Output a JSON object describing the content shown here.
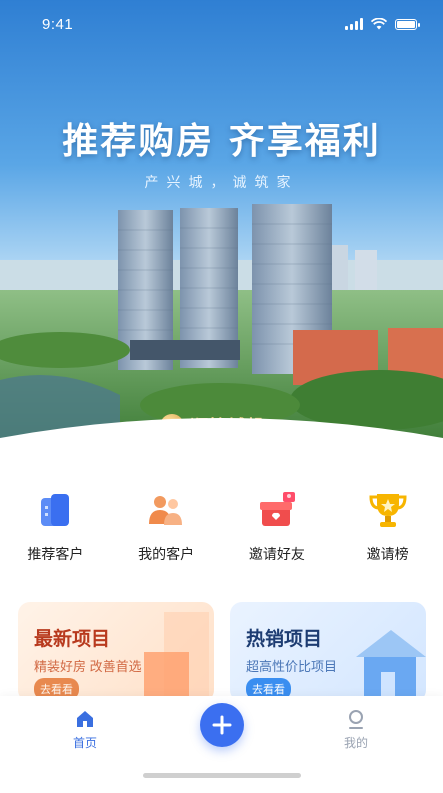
{
  "status_bar": {
    "time": "9:41"
  },
  "hero": {
    "slogan": "推荐购房 齐享福利",
    "subslogan": "产兴城，诚筑家",
    "brand_name": "顺控城投"
  },
  "menu": [
    {
      "label": "推荐客户",
      "icon": "recommend-customer-icon"
    },
    {
      "label": "我的客户",
      "icon": "my-customers-icon"
    },
    {
      "label": "邀请好友",
      "icon": "invite-friends-gift-icon"
    },
    {
      "label": "邀请榜",
      "icon": "trophy-icon"
    }
  ],
  "cards": {
    "latest": {
      "title": "最新项目",
      "subtitle": "精装好房 改善首选",
      "button": "去看看"
    },
    "hot": {
      "title": "热销项目",
      "subtitle": "超高性价比项目",
      "button": "去看看"
    }
  },
  "tabbar": {
    "home": "首页",
    "mine": "我的"
  },
  "colors": {
    "accent": "#3b6ff0",
    "hot_title": "#1d3c72",
    "latest_title": "#b83a1e"
  }
}
